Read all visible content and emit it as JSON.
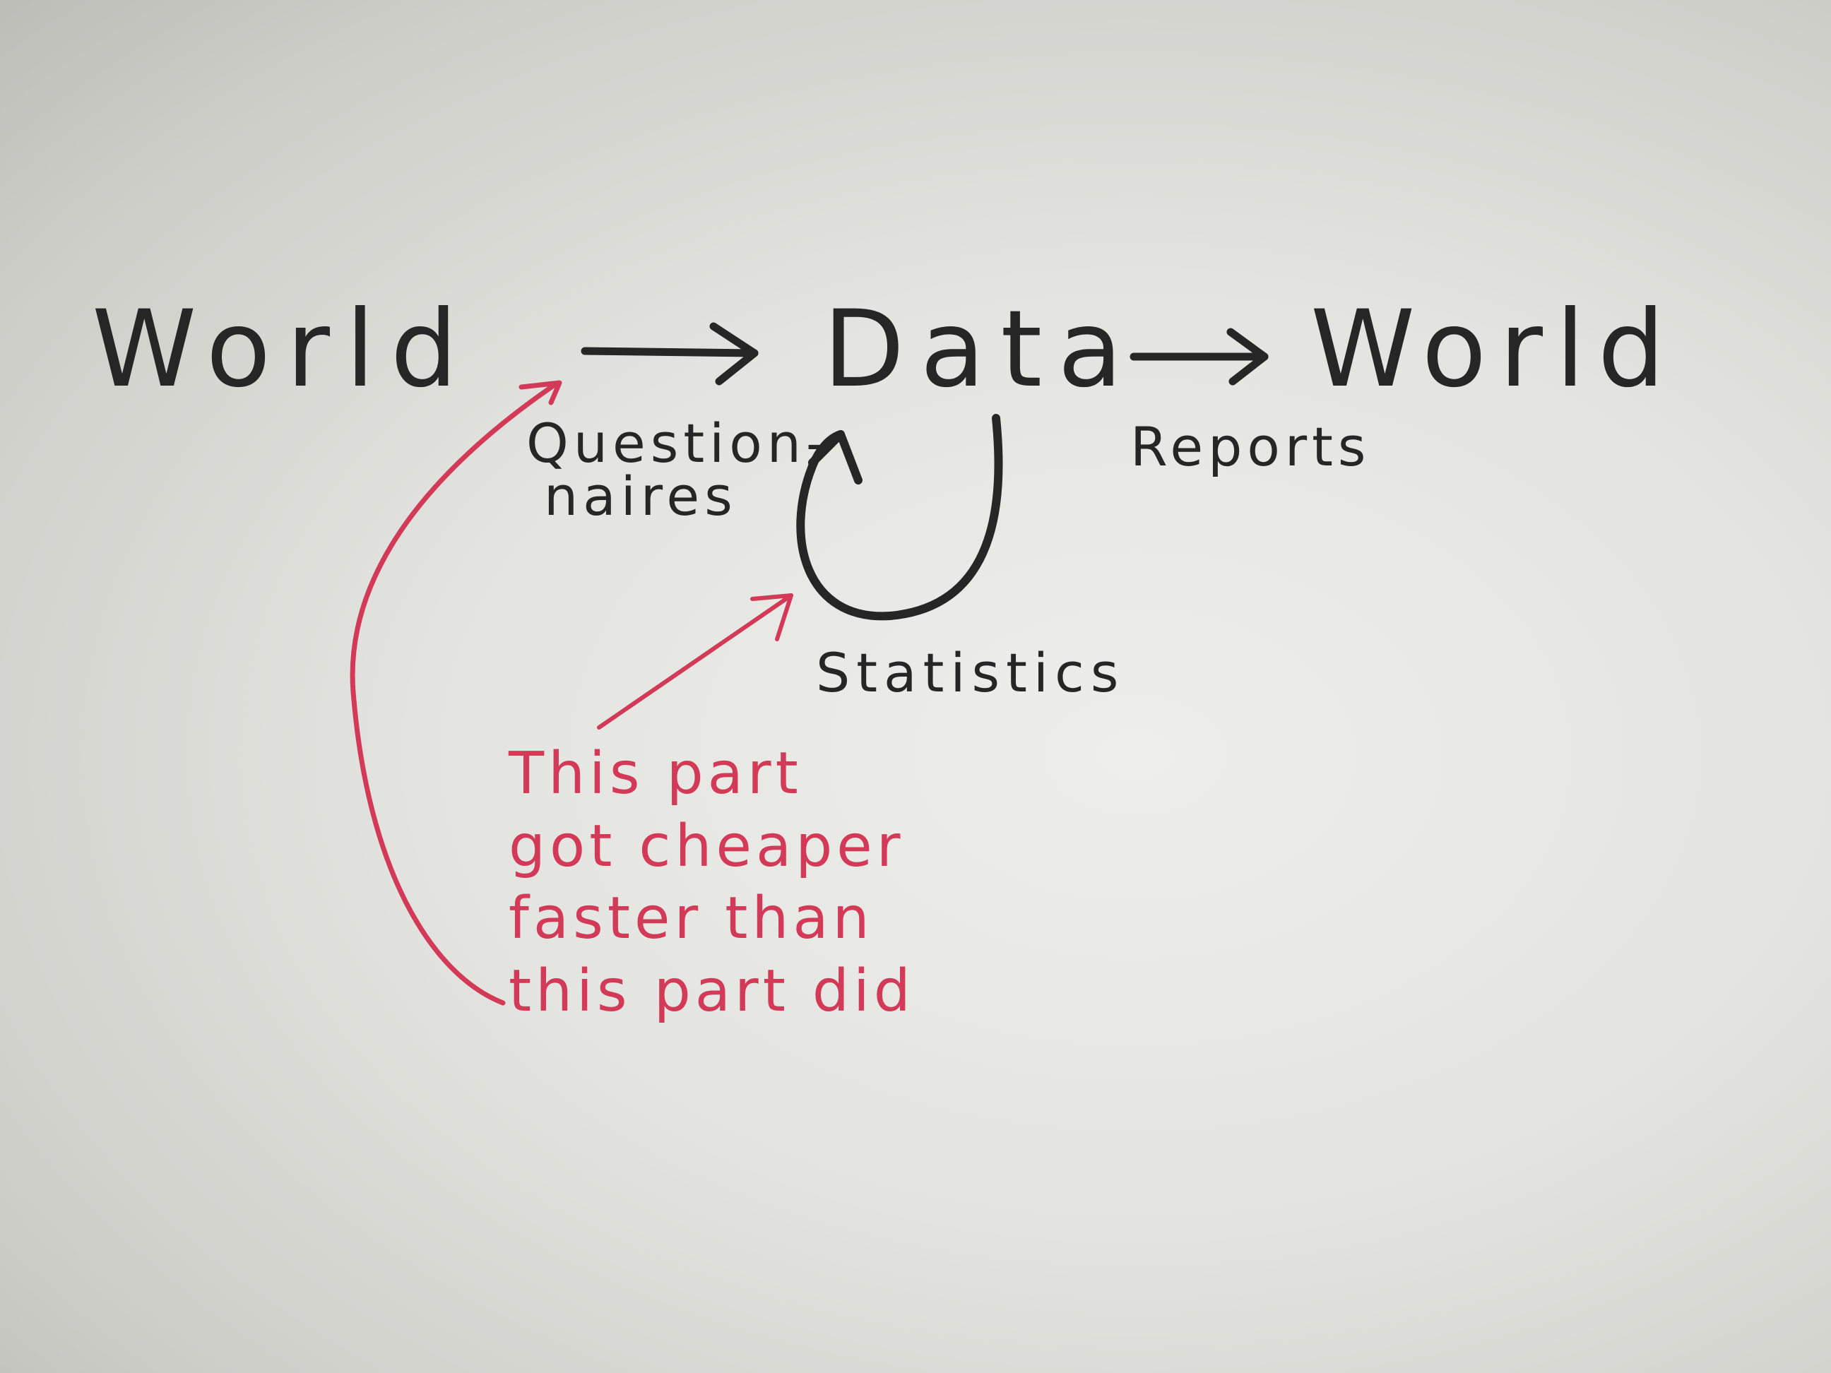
{
  "diagram": {
    "nodes": {
      "world_source": "World",
      "data": "Data",
      "world_output": "World"
    },
    "edge_labels": {
      "questionnaires_line1": "Question-",
      "questionnaires_line2": "naires",
      "reports": "Reports",
      "statistics": "Statistics"
    },
    "annotation": {
      "line1": "This part",
      "line2": "got cheaper",
      "line3": "faster than",
      "line4": "this part did"
    }
  },
  "colors": {
    "ink_black": "#262626",
    "ink_red": "#d23a58",
    "paper": "#e3e3df"
  }
}
